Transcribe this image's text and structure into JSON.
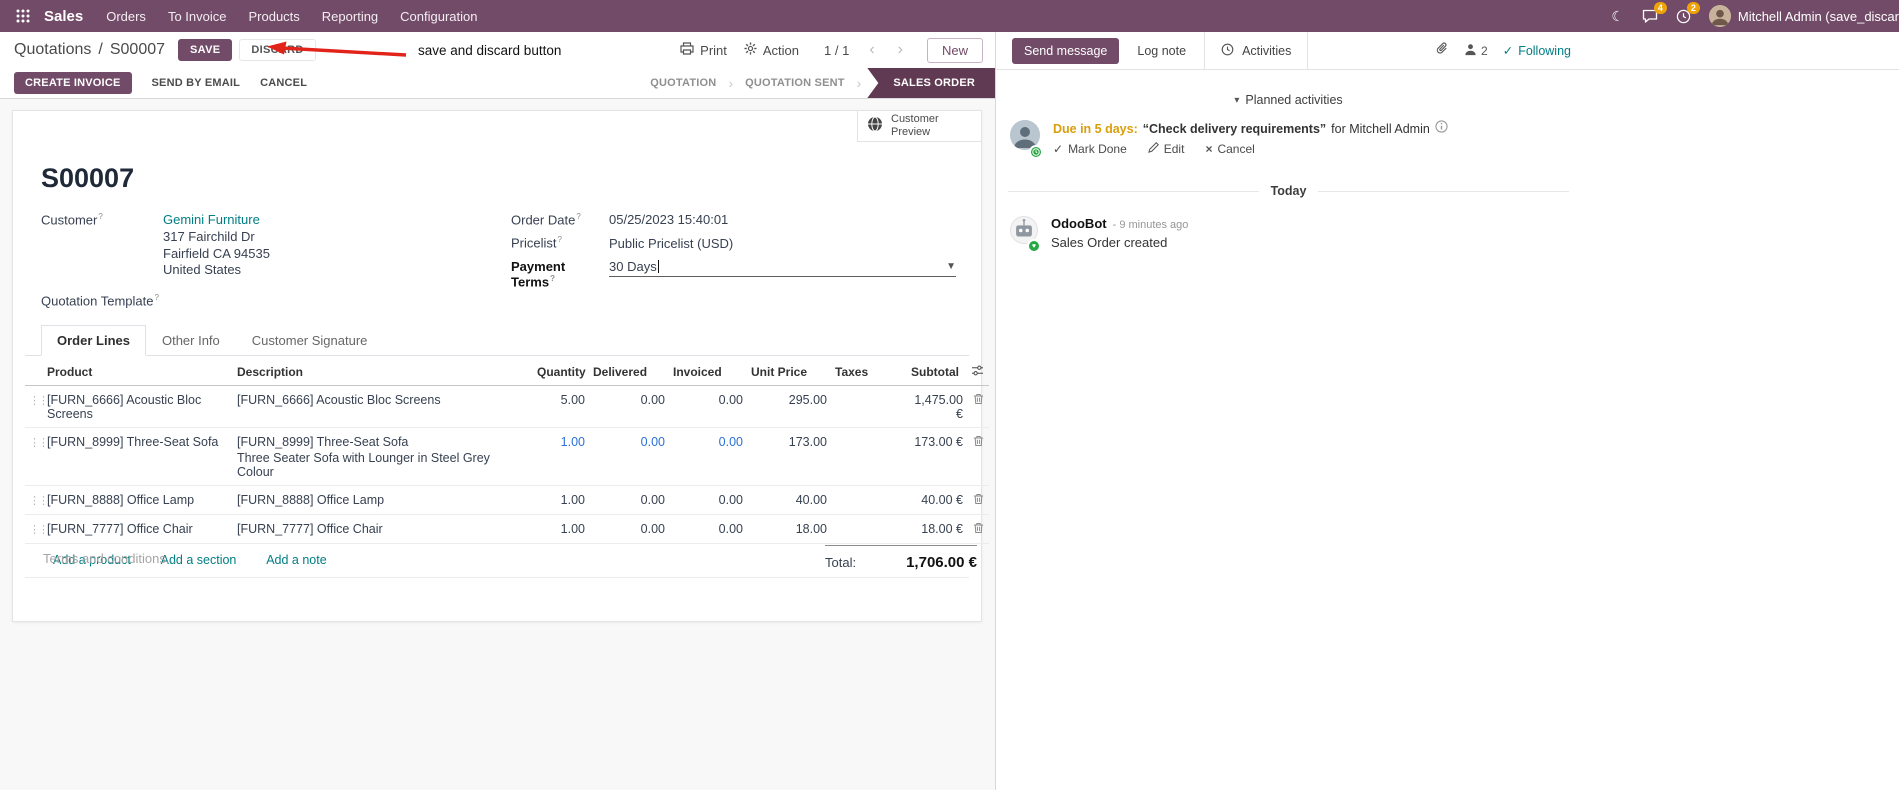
{
  "colors": {
    "brand": "#714B67",
    "statusbar_active": "#603A52",
    "link_teal": "#017E84",
    "accent_blue": "#2D6FD6",
    "warning_amber": "#D99E0B",
    "badge_orange": "#EFA30A",
    "success_green": "#28a745",
    "annotation_red": "#E2231A"
  },
  "topbar": {
    "app_name": "Sales",
    "menus": [
      "Orders",
      "To Invoice",
      "Products",
      "Reporting",
      "Configuration"
    ],
    "message_badge": "4",
    "activity_badge": "2",
    "user_name": "Mitchell Admin (save_discar"
  },
  "control_panel": {
    "breadcrumb_parent": "Quotations",
    "breadcrumb_sep": "/",
    "breadcrumb_current": "S00007",
    "save": "SAVE",
    "discard": "DISCARD",
    "annotation": "save and discard button",
    "print": "Print",
    "action": "Action",
    "pager": "1 / 1",
    "new": "New"
  },
  "statusbar": {
    "create_invoice": "CREATE INVOICE",
    "send_by_email": "SEND BY EMAIL",
    "cancel": "CANCEL",
    "quotation": "QUOTATION",
    "quotation_sent": "QUOTATION SENT",
    "sales_order": "SALES ORDER"
  },
  "form": {
    "customer_preview": "Customer Preview",
    "title": "S00007",
    "hint": "?",
    "customer_label": "Customer",
    "customer_name": "Gemini Furniture",
    "address_line1": "317 Fairchild Dr",
    "address_line2": "Fairfield CA 94535",
    "address_line3": "United States",
    "quotation_template_label": "Quotation Template",
    "order_date_label": "Order Date",
    "order_date_value": "05/25/2023 15:40:01",
    "pricelist_label": "Pricelist",
    "pricelist_value": "Public Pricelist (USD)",
    "payment_terms_label": "Payment Terms",
    "payment_terms_value": "30 Days",
    "tab_order_lines": "Order Lines",
    "tab_other_info": "Other Info",
    "tab_customer_signature": "Customer Signature",
    "table": {
      "col_product": "Product",
      "col_description": "Description",
      "col_quantity": "Quantity",
      "col_delivered": "Delivered",
      "col_invoiced": "Invoiced",
      "col_unit_price": "Unit Price",
      "col_taxes": "Taxes",
      "col_subtotal": "Subtotal",
      "rows": [
        {
          "product": "[FURN_6666] Acoustic Bloc Screens",
          "description": "[FURN_6666] Acoustic Bloc Screens",
          "quantity": "5.00",
          "delivered": "0.00",
          "invoiced": "0.00",
          "unit_price": "295.00",
          "subtotal": "1,475.00 €"
        },
        {
          "product": "[FURN_8999] Three-Seat Sofa",
          "description": "[FURN_8999] Three-Seat Sofa",
          "description2": "Three Seater Sofa with Lounger in Steel Grey Colour",
          "quantity": "1.00",
          "delivered": "0.00",
          "invoiced": "0.00",
          "unit_price": "173.00",
          "subtotal": "173.00 €"
        },
        {
          "product": "[FURN_8888] Office Lamp",
          "description": "[FURN_8888] Office Lamp",
          "quantity": "1.00",
          "delivered": "0.00",
          "invoiced": "0.00",
          "unit_price": "40.00",
          "subtotal": "40.00 €"
        },
        {
          "product": "[FURN_7777] Office Chair",
          "description": "[FURN_7777] Office Chair",
          "quantity": "1.00",
          "delivered": "0.00",
          "invoiced": "0.00",
          "unit_price": "18.00",
          "subtotal": "18.00 €"
        }
      ],
      "add_product": "Add a product",
      "add_section": "Add a section",
      "add_note": "Add a note"
    },
    "terms_placeholder": "Terms and conditions...",
    "total_label": "Total:",
    "total_value": "1,706.00 €"
  },
  "chatter": {
    "send_message": "Send message",
    "log_note": "Log note",
    "activities": "Activities",
    "followers_count": "2",
    "following": "Following",
    "planned_header": "Planned activities",
    "activity_due": "Due in 5 days:",
    "activity_summary": "“Check delivery requirements”",
    "activity_for": "for Mitchell Admin",
    "mark_done": "Mark Done",
    "edit": "Edit",
    "cancel": "Cancel",
    "today": "Today",
    "message_author": "OdooBot",
    "message_time": "- 9 minutes ago",
    "message_body": "Sales Order created"
  }
}
